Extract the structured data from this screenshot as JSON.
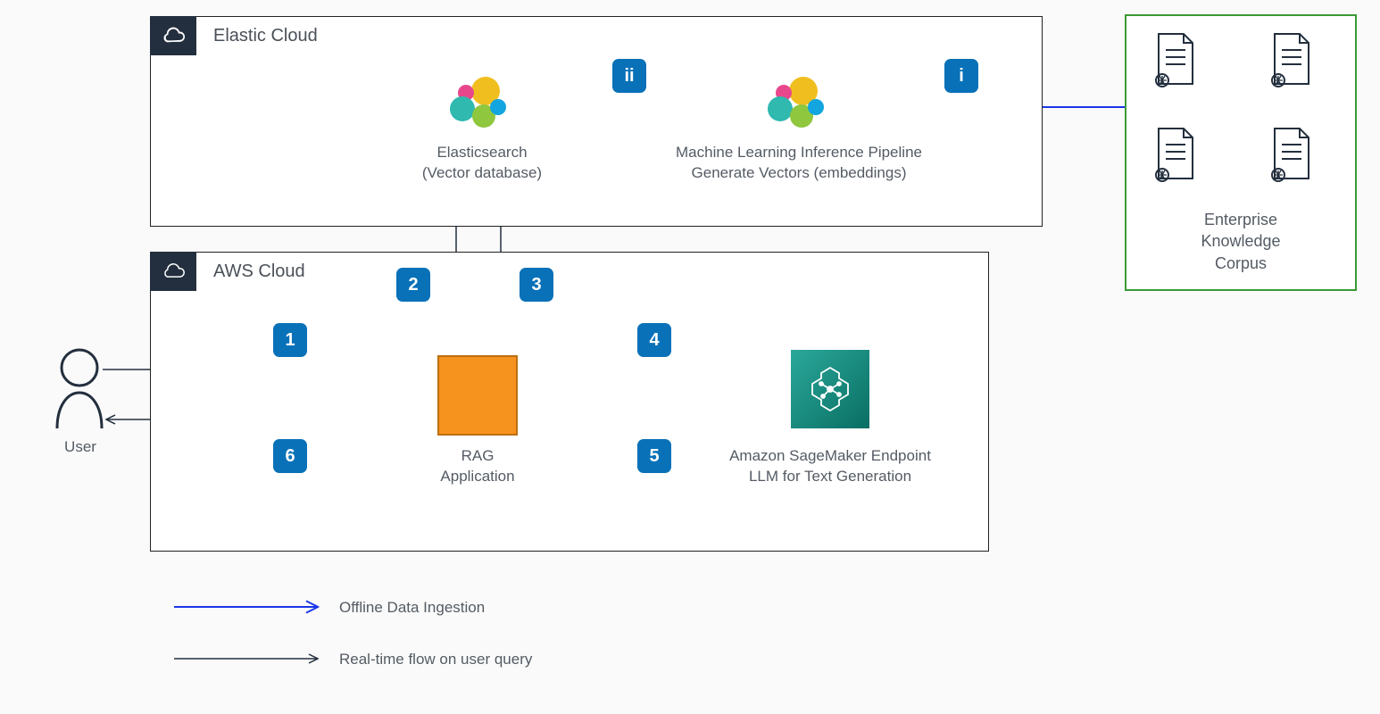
{
  "containers": {
    "elastic": {
      "title": "Elastic Cloud"
    },
    "aws": {
      "title": "AWS Cloud"
    },
    "corpus": {
      "title": "Enterprise\nKnowledge\nCorpus"
    }
  },
  "nodes": {
    "user": "User",
    "elasticsearch": "Elasticsearch\n(Vector database)",
    "ml_pipeline": "Machine Learning Inference Pipeline\nGenerate Vectors (embeddings)",
    "rag": "RAG\nApplication",
    "sagemaker": "Amazon SageMaker Endpoint\nLLM for Text Generation"
  },
  "steps": {
    "s1": "1",
    "s2": "2",
    "s3": "3",
    "s4": "4",
    "s5": "5",
    "s6": "6",
    "si": "i",
    "sii": "ii"
  },
  "legend": {
    "offline": "Offline Data Ingestion",
    "realtime": "Real-time flow on user query"
  }
}
